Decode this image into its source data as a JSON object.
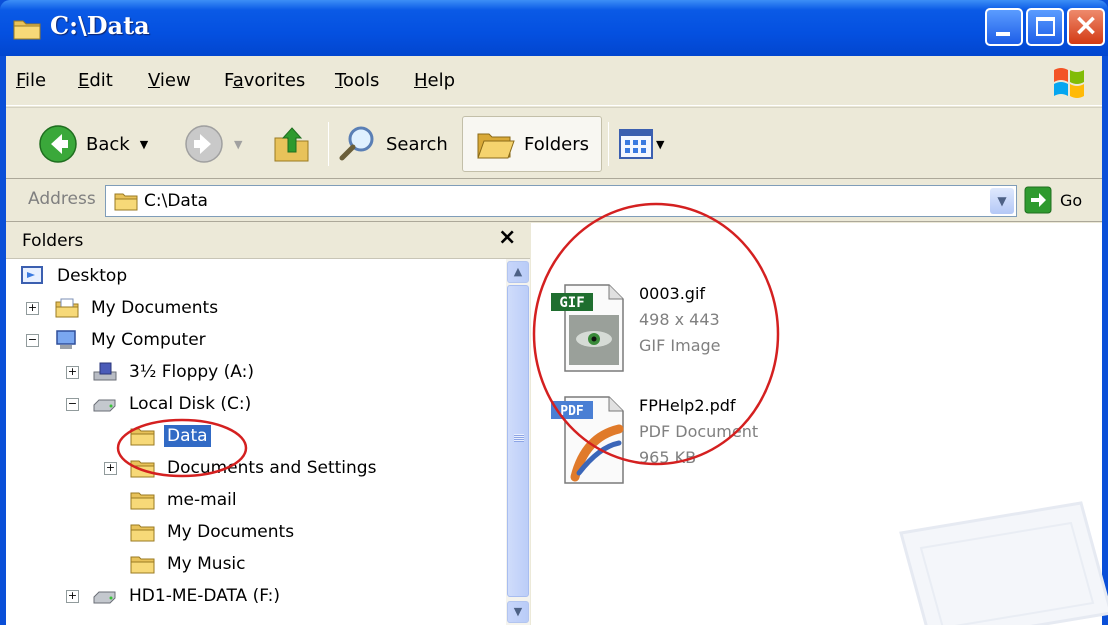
{
  "window": {
    "title": "C:\\Data",
    "controls": [
      "minimize",
      "maximize",
      "close"
    ]
  },
  "menubar": {
    "items": [
      {
        "label": "File",
        "accel": "F"
      },
      {
        "label": "Edit",
        "accel": "E"
      },
      {
        "label": "View",
        "accel": "V"
      },
      {
        "label": "Favorites",
        "accel": "a"
      },
      {
        "label": "Tools",
        "accel": "T"
      },
      {
        "label": "Help",
        "accel": "H"
      }
    ]
  },
  "toolbar": {
    "back_label": "Back",
    "search_label": "Search",
    "folders_label": "Folders",
    "icons": [
      "back-arrow-icon",
      "forward-arrow-icon",
      "up-folder-icon",
      "search-magnifier-icon",
      "folders-icon",
      "views-icon"
    ]
  },
  "address": {
    "label": "Address",
    "value": "C:\\Data",
    "go_label": "Go"
  },
  "folders_pane": {
    "title": "Folders",
    "close_glyph": "×",
    "tree": [
      {
        "label": "Desktop",
        "level": 0,
        "expander": "",
        "icon": "desktop-icon"
      },
      {
        "label": "My Documents",
        "level": 1,
        "expander": "+",
        "icon": "my-documents-icon"
      },
      {
        "label": "My Computer",
        "level": 1,
        "expander": "−",
        "icon": "my-computer-icon"
      },
      {
        "label": "3½ Floppy (A:)",
        "level": 2,
        "expander": "+",
        "icon": "floppy-drive-icon"
      },
      {
        "label": "Local Disk (C:)",
        "level": 2,
        "expander": "−",
        "icon": "hard-disk-icon"
      },
      {
        "label": "Data",
        "level": 3,
        "expander": "",
        "icon": "folder-icon",
        "selected": true
      },
      {
        "label": "Documents and Settings",
        "level": 3,
        "expander": "+",
        "icon": "folder-icon"
      },
      {
        "label": "me-mail",
        "level": 3,
        "expander": "",
        "icon": "folder-icon"
      },
      {
        "label": "My Documents",
        "level": 3,
        "expander": "",
        "icon": "folder-icon"
      },
      {
        "label": "My Music",
        "level": 3,
        "expander": "",
        "icon": "folder-icon"
      },
      {
        "label": "HD1-ME-DATA (F:)",
        "level": 2,
        "expander": "+",
        "icon": "hard-disk-icon"
      }
    ]
  },
  "files": [
    {
      "name": "0003.gif",
      "detail1": "498 x 443",
      "detail2": "GIF Image",
      "icon": "gif-file-icon"
    },
    {
      "name": "FPHelp2.pdf",
      "detail1": "PDF Document",
      "detail2": "965 KB",
      "icon": "pdf-file-icon"
    }
  ],
  "colors": {
    "titlebar": "#0450e0",
    "selection": "#316ac5",
    "annotation": "#d42020",
    "chrome": "#ece9d8"
  }
}
